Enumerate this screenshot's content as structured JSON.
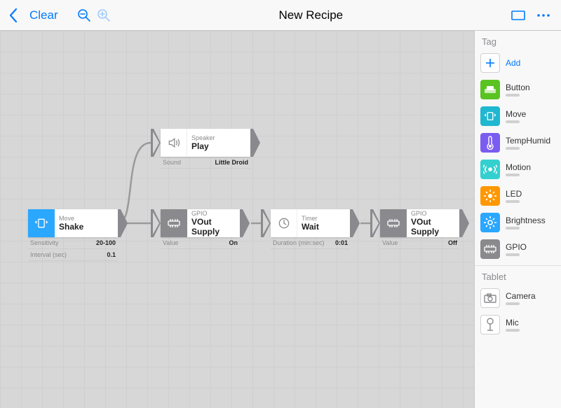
{
  "toolbar": {
    "clear_label": "Clear",
    "title": "New Recipe"
  },
  "sidebar": {
    "sections": {
      "tag": {
        "header": "Tag",
        "add_label": "Add",
        "items": [
          {
            "label": "Button",
            "color": "c-green",
            "icon": "button-icon"
          },
          {
            "label": "Move",
            "color": "c-teal",
            "icon": "move-icon"
          },
          {
            "label": "TempHumid",
            "color": "c-purple",
            "icon": "thermometer-icon"
          },
          {
            "label": "Motion",
            "color": "c-cyan",
            "icon": "motion-icon"
          },
          {
            "label": "LED",
            "color": "c-orange",
            "icon": "led-icon"
          },
          {
            "label": "Brightness",
            "color": "c-sky",
            "icon": "brightness-icon"
          },
          {
            "label": "GPIO",
            "color": "c-grey",
            "icon": "gpio-icon"
          }
        ]
      },
      "tablet": {
        "header": "Tablet",
        "items": [
          {
            "label": "Camera",
            "icon": "camera-icon"
          },
          {
            "label": "Mic",
            "icon": "mic-icon"
          }
        ]
      }
    }
  },
  "nodes": {
    "shake": {
      "category": "Move",
      "title": "Shake",
      "params": [
        {
          "name": "Sensitivity",
          "value": "20-100"
        },
        {
          "name": "Interval (sec)",
          "value": "0.1"
        }
      ]
    },
    "speaker": {
      "category": "Speaker",
      "title": "Play",
      "params": [
        {
          "name": "Sound",
          "value": "Little Droid"
        }
      ]
    },
    "gpio1": {
      "category": "GPIO",
      "title": "VOut Supply",
      "params": [
        {
          "name": "Value",
          "value": "On"
        }
      ]
    },
    "timer": {
      "category": "Timer",
      "title": "Wait",
      "params": [
        {
          "name": "Duration (min:sec)",
          "value": "0:01"
        }
      ]
    },
    "gpio2": {
      "category": "GPIO",
      "title": "VOut Supply",
      "params": [
        {
          "name": "Value",
          "value": "Off"
        }
      ]
    }
  }
}
